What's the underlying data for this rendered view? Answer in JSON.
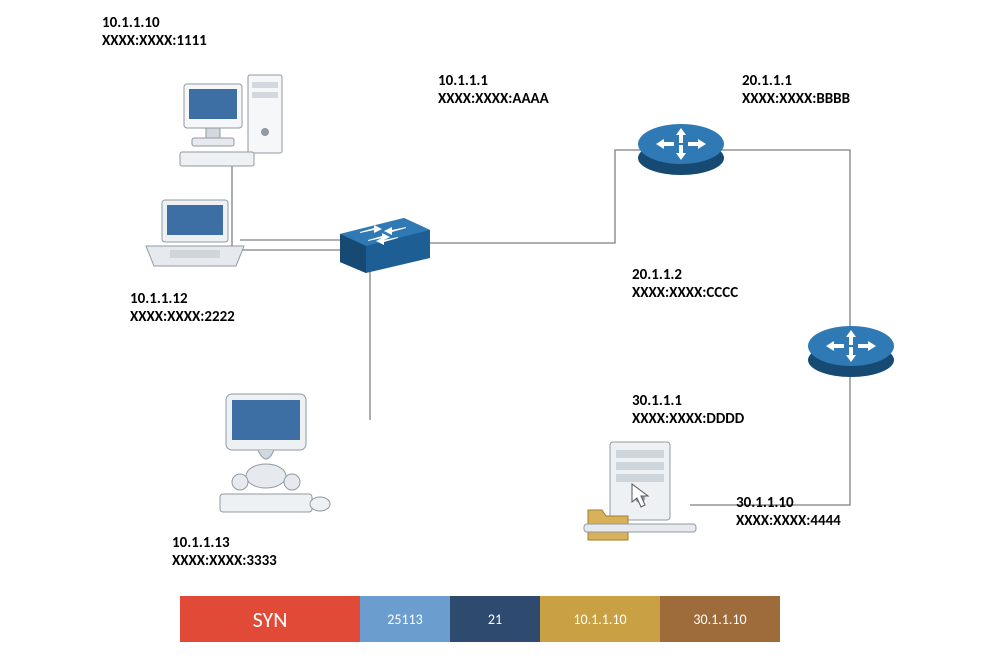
{
  "nodes": {
    "pc1": {
      "ip": "10.1.1.10",
      "mac": "XXXX:XXXX:1111"
    },
    "laptop": {
      "ip": "10.1.1.12",
      "mac": "XXXX:XXXX:2222"
    },
    "pc2": {
      "ip": "10.1.1.13",
      "mac": "XXXX:XXXX:3333"
    },
    "r1_lan": {
      "ip": "10.1.1.1",
      "mac": "XXXX:XXXX:AAAA"
    },
    "r1_wan": {
      "ip": "20.1.1.1",
      "mac": "XXXX:XXXX:BBBB"
    },
    "r2_wan": {
      "ip": "20.1.1.2",
      "mac": "XXXX:XXXX:CCCC"
    },
    "r2_lan": {
      "ip": "30.1.1.1",
      "mac": "XXXX:XXXX:DDDD"
    },
    "server": {
      "ip": "30.1.1.10",
      "mac": "XXXX:XXXX:4444"
    }
  },
  "packet": {
    "flag": "SYN",
    "src_port": "25113",
    "dst_port": "21",
    "src_ip": "10.1.1.10",
    "dst_ip": "30.1.1.10"
  }
}
